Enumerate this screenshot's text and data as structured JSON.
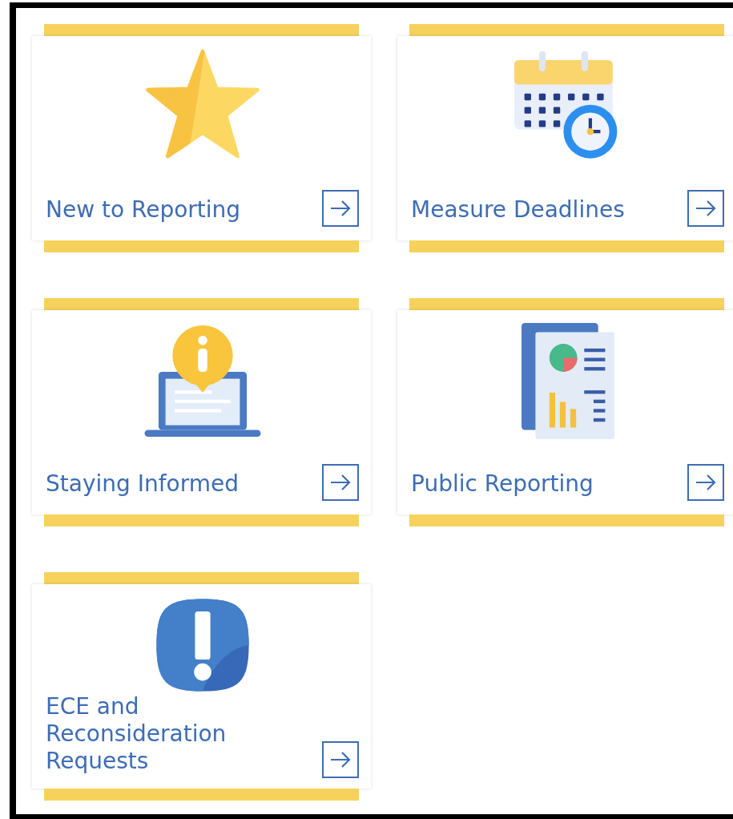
{
  "cards": [
    {
      "kind": "star",
      "title": "New to Reporting"
    },
    {
      "kind": "calendar",
      "title": "Measure Deadlines"
    },
    {
      "kind": "laptop",
      "title": "Staying Informed"
    },
    {
      "kind": "report",
      "title": "Public Reporting"
    },
    {
      "kind": "alert",
      "title": "ECE and Reconsideration Requests"
    }
  ]
}
